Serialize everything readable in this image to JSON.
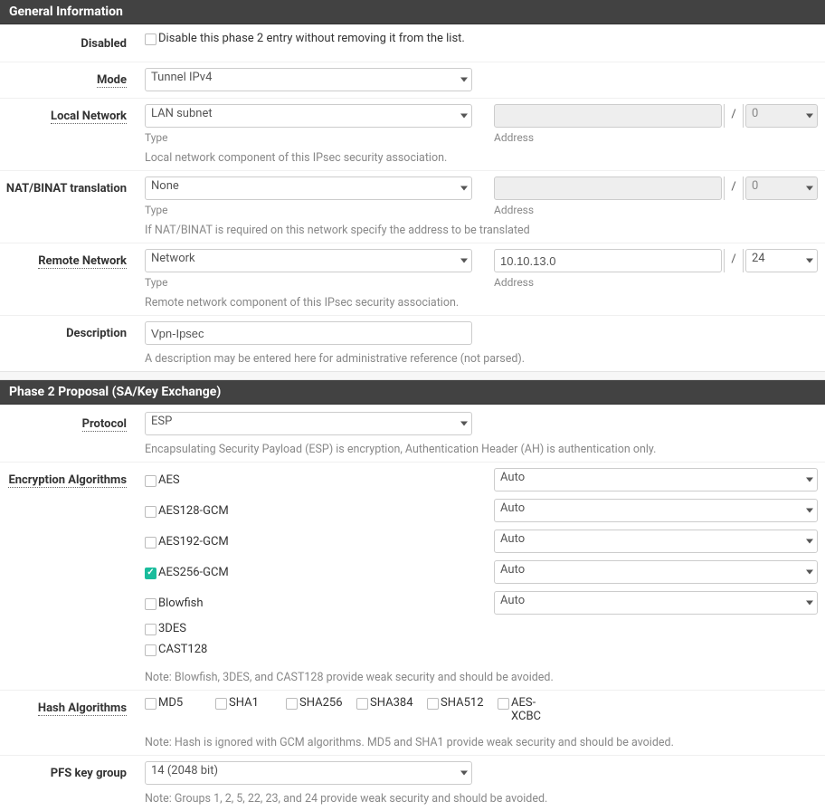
{
  "panel_general": {
    "title": "General Information",
    "disabled": {
      "label": "Disabled",
      "checkbox_label": "Disable this phase 2 entry without removing it from the list."
    },
    "mode": {
      "label": "Mode",
      "value": "Tunnel IPv4"
    },
    "local_network": {
      "label": "Local Network",
      "type_value": "LAN subnet",
      "type_sub": "Type",
      "addr_sub": "Address",
      "cidr_value": "0",
      "help": "Local network component of this IPsec security association."
    },
    "nat": {
      "label": "NAT/BINAT translation",
      "type_value": "None",
      "type_sub": "Type",
      "addr_sub": "Address",
      "cidr_value": "0",
      "help": "If NAT/BINAT is required on this network specify the address to be translated"
    },
    "remote_network": {
      "label": "Remote Network",
      "type_value": "Network",
      "type_sub": "Type",
      "addr_value": "10.10.13.0",
      "addr_sub": "Address",
      "cidr_value": "24",
      "help": "Remote network component of this IPsec security association."
    },
    "description": {
      "label": "Description",
      "value": "Vpn-Ipsec",
      "help": "A description may be entered here for administrative reference (not parsed)."
    }
  },
  "panel_p2": {
    "title": "Phase 2 Proposal (SA/Key Exchange)",
    "protocol": {
      "label": "Protocol",
      "value": "ESP",
      "help": "Encapsulating Security Payload (ESP) is encryption, Authentication Header (AH) is authentication only."
    },
    "encryption": {
      "label": "Encryption Algorithms",
      "algos": [
        {
          "name": "AES",
          "checked": false,
          "has_keylen": true,
          "keylen": "Auto"
        },
        {
          "name": "AES128-GCM",
          "checked": false,
          "has_keylen": true,
          "keylen": "Auto"
        },
        {
          "name": "AES192-GCM",
          "checked": false,
          "has_keylen": true,
          "keylen": "Auto"
        },
        {
          "name": "AES256-GCM",
          "checked": true,
          "has_keylen": true,
          "keylen": "Auto"
        },
        {
          "name": "Blowfish",
          "checked": false,
          "has_keylen": true,
          "keylen": "Auto"
        },
        {
          "name": "3DES",
          "checked": false,
          "has_keylen": false
        },
        {
          "name": "CAST128",
          "checked": false,
          "has_keylen": false
        }
      ],
      "note": "Note: Blowfish, 3DES, and CAST128 provide weak security and should be avoided."
    },
    "hash": {
      "label": "Hash Algorithms",
      "algos": [
        "MD5",
        "SHA1",
        "SHA256",
        "SHA384",
        "SHA512",
        "AES-XCBC"
      ],
      "note": "Note: Hash is ignored with GCM algorithms. MD5 and SHA1 provide weak security and should be avoided."
    },
    "pfs": {
      "label": "PFS key group",
      "value": "14 (2048 bit)",
      "note": "Note: Groups 1, 2, 5, 22, 23, and 24 provide weak security and should be avoided."
    }
  },
  "slash": "/"
}
